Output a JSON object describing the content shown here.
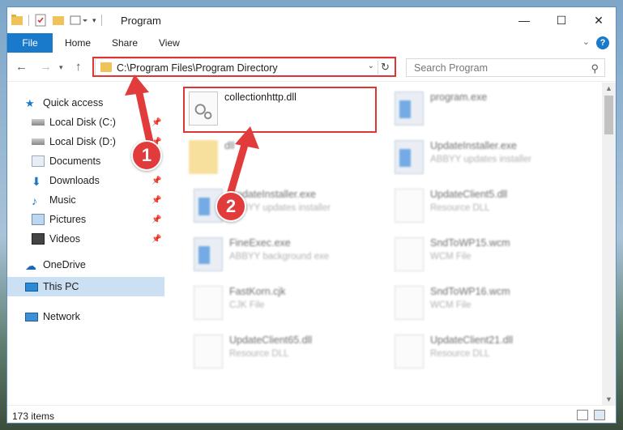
{
  "window": {
    "title": "Program"
  },
  "ribbon": {
    "tabs": [
      "File",
      "Home",
      "Share",
      "View"
    ],
    "help": "?"
  },
  "address": {
    "path": "C:\\Program Files\\Program Directory"
  },
  "search": {
    "placeholder": "Search Program"
  },
  "sidebar": {
    "items": [
      {
        "label": "Quick access",
        "icon": "star-icon"
      },
      {
        "label": "Local Disk (C:)",
        "icon": "drive-icon",
        "pinned": true
      },
      {
        "label": "Local Disk (D:)",
        "icon": "drive-icon",
        "pinned": true
      },
      {
        "label": "Documents",
        "icon": "documents-icon",
        "pinned": true
      },
      {
        "label": "Downloads",
        "icon": "download-icon",
        "pinned": true
      },
      {
        "label": "Music",
        "icon": "music-icon",
        "pinned": true
      },
      {
        "label": "Pictures",
        "icon": "pictures-icon",
        "pinned": true
      },
      {
        "label": "Videos",
        "icon": "videos-icon",
        "pinned": true
      },
      {
        "label": "OneDrive",
        "icon": "cloud-icon"
      },
      {
        "label": "This PC",
        "icon": "computer-icon",
        "selected": true
      },
      {
        "label": "Network",
        "icon": "network-icon"
      }
    ]
  },
  "files": [
    {
      "name": "collectionhttp.dll",
      "type": "",
      "icon": "dll-icon"
    },
    {
      "name": "program.exe",
      "type": "",
      "icon": "exe-icon"
    },
    {
      "name": "dll",
      "type": "",
      "icon": "folder-icon"
    },
    {
      "name": "UpdateInstaller.exe",
      "type": "ABBYY updates installer",
      "icon": "exe-icon"
    },
    {
      "name": "UpdateInstaller.exe",
      "type": "ABBYY updates installer",
      "icon": "exe-icon"
    },
    {
      "name": "UpdateClient5.dll",
      "type": "Resource DLL",
      "icon": "dll-icon"
    },
    {
      "name": "FineExec.exe",
      "type": "ABBYY background exe",
      "icon": "exe-icon"
    },
    {
      "name": "SndToWP15.wcm",
      "type": "WCM File",
      "icon": "doc-icon"
    },
    {
      "name": "FastKorn.cjk",
      "type": "CJK File",
      "icon": "doc-icon"
    },
    {
      "name": "SndToWP16.wcm",
      "type": "WCM File",
      "icon": "doc-icon"
    },
    {
      "name": "UpdateClient65.dll",
      "type": "Resource DLL",
      "icon": "dll-icon"
    },
    {
      "name": "UpdateClient21.dll",
      "type": "Resource DLL",
      "icon": "dll-icon"
    }
  ],
  "status": {
    "count": "173 items"
  },
  "annotations": {
    "step1": "1",
    "step2": "2"
  },
  "colors": {
    "accent": "#1979ca",
    "highlight": "#e03535",
    "selected": "#cce0f4"
  }
}
